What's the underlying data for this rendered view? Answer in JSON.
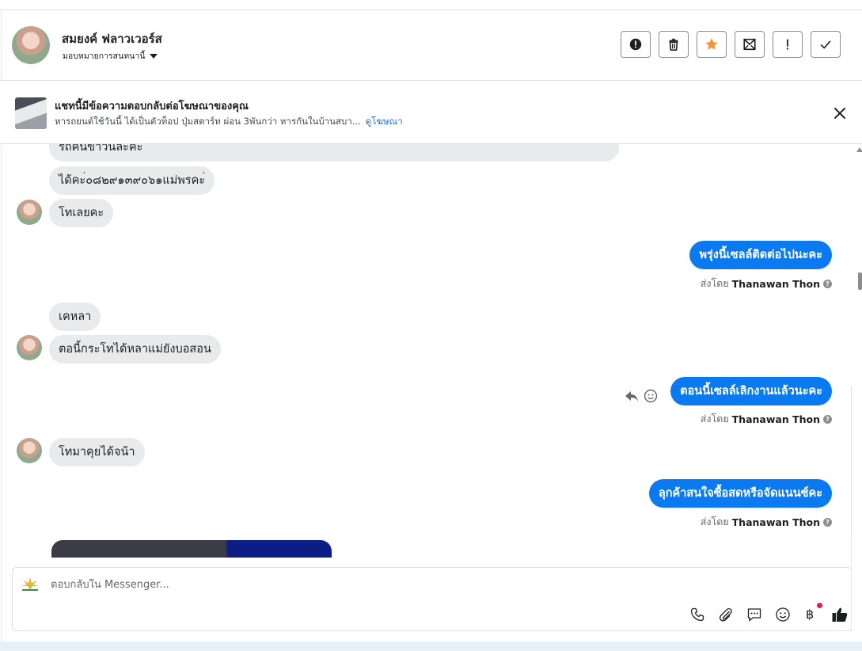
{
  "header": {
    "contact_name": "สมยงค์ ฟลาวเวอร์ส",
    "assign_label": "มอบหมายการสนทนานี้"
  },
  "banner": {
    "title": "แชทนี้มีข้อความตอบกลับต่อโฆษณาของคุณ",
    "subtitle": "หารถยนต์ใช้วันนี้ ได้เป็นตัวท็อป ปุ่มสตาร์ท ผ่อน 3พันกว่า หารกันในบ้านสบา...",
    "link_label": "ดูโฆษณา"
  },
  "messages": [
    {
      "dir": "in",
      "text": "รถคันขาวนิละคะ"
    },
    {
      "dir": "in",
      "text": "ได้คะ่๐๘๒๙๑๓๙๐๖๑แม่พรคะ่"
    },
    {
      "dir": "in",
      "text": "โทเลยคะ"
    },
    {
      "dir": "out",
      "text": "พรุ่งนี้เซลล์ติดต่อไปนะคะ",
      "sent_prefix": "ส่งโดย",
      "sender": "Thanawan Thon"
    },
    {
      "dir": "in",
      "text": "เคหลา"
    },
    {
      "dir": "in",
      "text": "ตอนี้กระโทได้หลาแม่ยังบอสอน"
    },
    {
      "dir": "out",
      "text": "ตอนนี้เซลล์เลิกงานแล้วนะคะ",
      "sent_prefix": "ส่งโดย",
      "sender": "Thanawan Thon"
    },
    {
      "dir": "in",
      "text": "โทมาคุยได้จน้า"
    },
    {
      "dir": "out",
      "text": "ลุกค้าสนใจซื้อสดหรือจัดแนนซ์คะ",
      "sent_prefix": "ส่งโดย",
      "sender": "Thanawan Thon"
    }
  ],
  "composer": {
    "placeholder": "ตอบกลับใน Messenger...",
    "currency_symbol": "฿"
  },
  "colors": {
    "outgoing_bubble": "#0b7af0",
    "incoming_bubble": "#e9eaec",
    "star": "#f7923a",
    "link": "#1a6ed8"
  }
}
